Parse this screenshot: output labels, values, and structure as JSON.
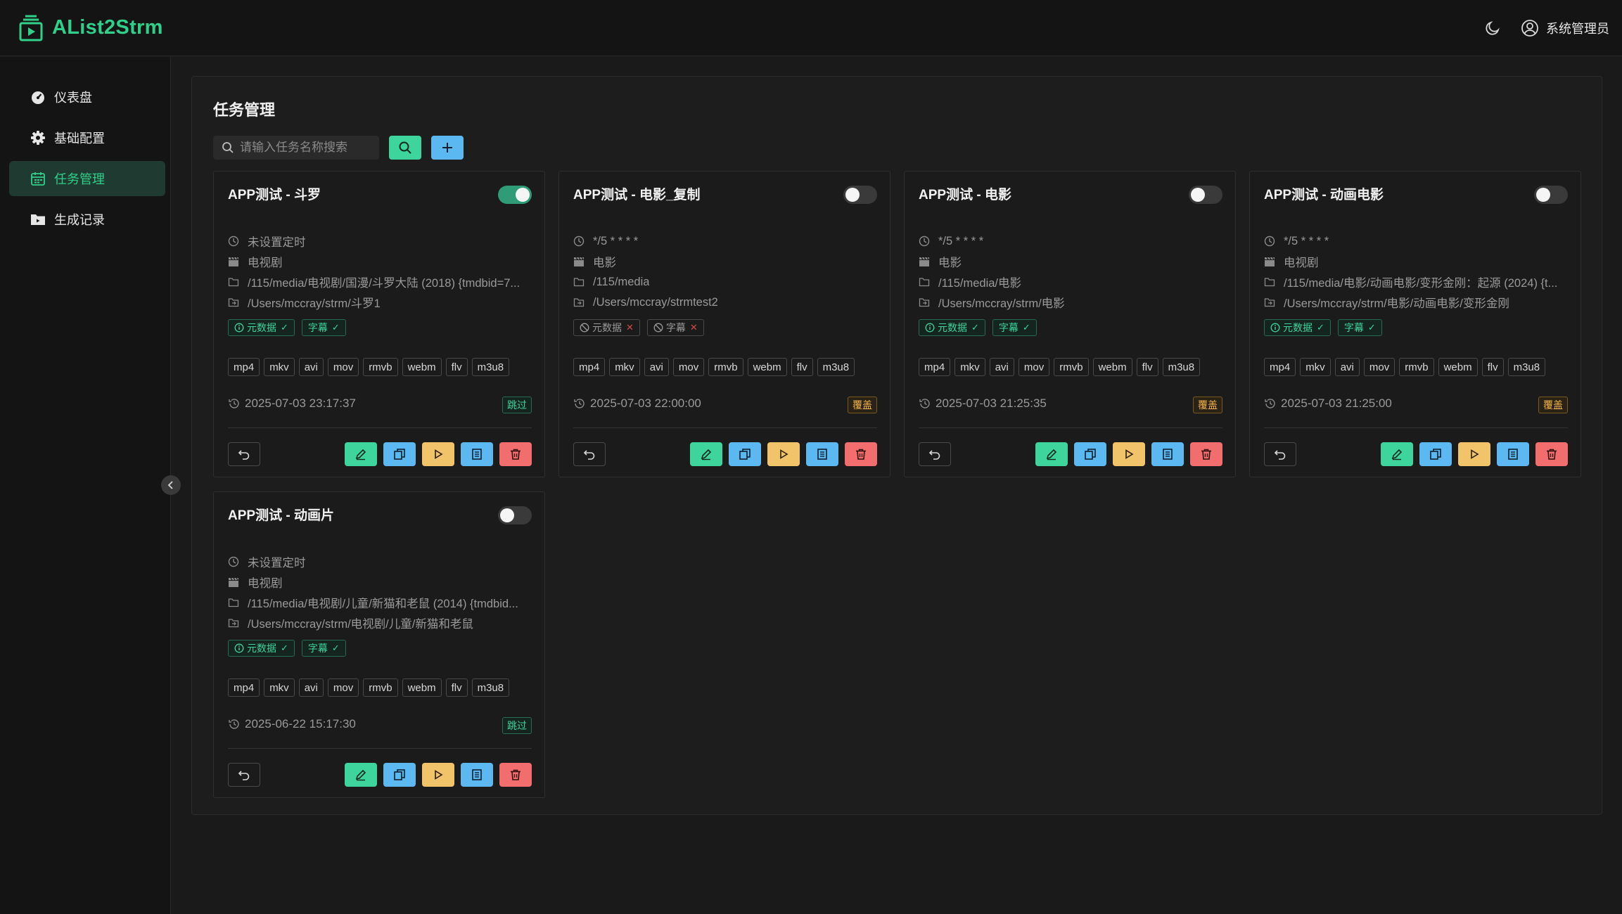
{
  "app": {
    "title": "AList2Strm",
    "user_name": "系统管理员"
  },
  "colors": {
    "accent": "#2fd08a",
    "edit": "#3ed59c",
    "copy": "#5bb8f0",
    "run": "#f2c46a",
    "delete": "#f26d6d"
  },
  "sidebar": {
    "items": [
      {
        "label": "仪表盘",
        "icon": "dashboard-icon"
      },
      {
        "label": "基础配置",
        "icon": "gear-icon"
      },
      {
        "label": "任务管理",
        "icon": "calendar-icon",
        "active": true
      },
      {
        "label": "生成记录",
        "icon": "folder-icon"
      }
    ]
  },
  "main": {
    "title": "任务管理",
    "search": {
      "placeholder": "请输入任务名称搜索",
      "value": ""
    },
    "ext_tags": [
      "mp4",
      "mkv",
      "avi",
      "mov",
      "rmvb",
      "webm",
      "flv",
      "m3u8"
    ],
    "badges": {
      "metadata": "元数据",
      "subtitle": "字幕"
    },
    "tasks": [
      {
        "name": "APP测试 - 斗罗",
        "enabled": true,
        "schedule": "未设置定时",
        "media_type": "电视剧",
        "source_path": "/115/media/电视剧/国漫/斗罗大陆 (2018) {tmdbid=7...",
        "target_path": "/Users/mccray/strm/斗罗1",
        "metadata": true,
        "subtitle": true,
        "last_run": "2025-07-03 23:17:37",
        "mode": "跳过"
      },
      {
        "name": "APP测试 - 电影_复制",
        "enabled": false,
        "schedule": "*/5 * * * *",
        "media_type": "电影",
        "source_path": "/115/media",
        "target_path": "/Users/mccray/strmtest2",
        "metadata": false,
        "subtitle": false,
        "last_run": "2025-07-03 22:00:00",
        "mode": "覆盖"
      },
      {
        "name": "APP测试 - 电影",
        "enabled": false,
        "schedule": "*/5 * * * *",
        "media_type": "电影",
        "source_path": "/115/media/电影",
        "target_path": "/Users/mccray/strm/电影",
        "metadata": true,
        "subtitle": true,
        "last_run": "2025-07-03 21:25:35",
        "mode": "覆盖"
      },
      {
        "name": "APP测试 - 动画电影",
        "enabled": false,
        "schedule": "*/5 * * * *",
        "media_type": "电视剧",
        "source_path": "/115/media/电影/动画电影/变形金刚：起源 (2024) {t...",
        "target_path": "/Users/mccray/strm/电影/动画电影/变形金刚",
        "metadata": true,
        "subtitle": true,
        "last_run": "2025-07-03 21:25:00",
        "mode": "覆盖"
      },
      {
        "name": "APP测试 - 动画片",
        "enabled": false,
        "schedule": "未设置定时",
        "media_type": "电视剧",
        "source_path": "/115/media/电视剧/儿童/新猫和老鼠 (2014) {tmdbid...",
        "target_path": "/Users/mccray/strm/电视剧/儿童/新猫和老鼠",
        "metadata": true,
        "subtitle": true,
        "last_run": "2025-06-22 15:17:30",
        "mode": "跳过"
      }
    ]
  }
}
